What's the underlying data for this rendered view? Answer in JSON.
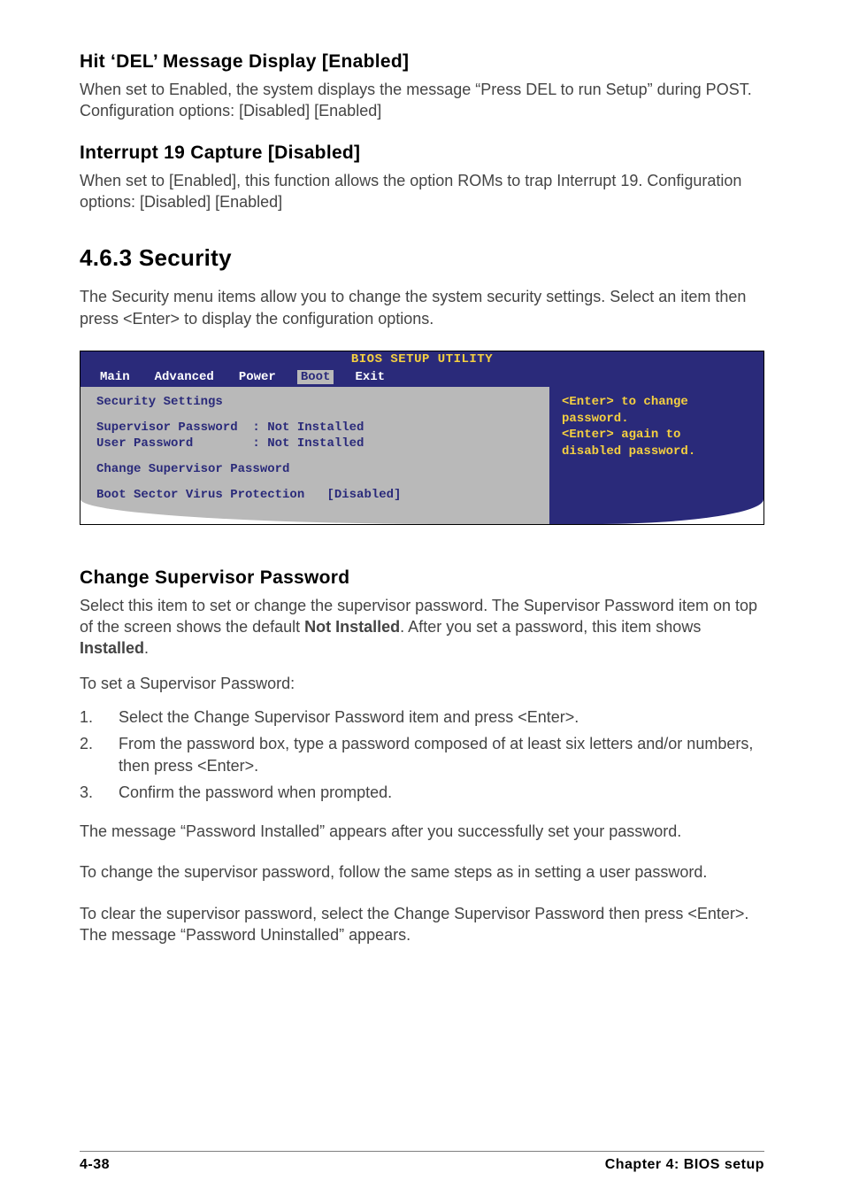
{
  "sections": {
    "hitDel": {
      "heading": "Hit ‘DEL’ Message Display [Enabled]",
      "body": "When set to Enabled, the system displays the message “Press DEL to run Setup” during POST. Configuration options: [Disabled] [Enabled]"
    },
    "interrupt": {
      "heading": "Interrupt 19 Capture [Disabled]",
      "body": "When set to [Enabled], this function allows the option ROMs to trap Interrupt 19. Configuration options: [Disabled] [Enabled]"
    },
    "security": {
      "heading": "4.6.3   Security",
      "body": "The Security menu items allow you to change the system security settings. Select an item then press <Enter> to display the configuration options."
    },
    "changePw": {
      "heading": "Change Supervisor Password",
      "para1a": "Select this item to set or change the supervisor password. The Supervisor Password item on top of the screen shows the default ",
      "notInstalled": "Not Installed",
      "para1b": ". After you set a password, this item shows ",
      "installed": "Installed",
      "para1c": ".",
      "para2": "To set a Supervisor Password:",
      "steps": [
        "Select the Change Supervisor Password item and press <Enter>.",
        "From the password box, type a password composed of at least six letters and/or numbers, then press <Enter>.",
        "Confirm the password when prompted."
      ],
      "para3": "The message “Password Installed” appears after you successfully set your password.",
      "para4": "To change the supervisor password, follow the same steps as in setting a user password.",
      "para5": "To clear the supervisor password, select the Change Supervisor Password then press <Enter>. The message “Password Uninstalled” appears."
    }
  },
  "bios": {
    "title": "BIOS SETUP UTILITY",
    "tabs": {
      "main": "Main",
      "advanced": "Advanced",
      "power": "Power",
      "boot": "Boot",
      "exit": "Exit"
    },
    "left": {
      "header": "Security Settings",
      "row1": "Supervisor Password  : Not Installed",
      "row2": "User Password        : Not Installed",
      "row3": "Change Supervisor Password",
      "row4": "Boot Sector Virus Protection   [Disabled]"
    },
    "right": {
      "l1": "<Enter> to change",
      "l2": "password.",
      "l3": "<Enter> again to",
      "l4": "disabled password."
    }
  },
  "footer": {
    "left": "4-38",
    "right": "Chapter 4: BIOS setup"
  }
}
